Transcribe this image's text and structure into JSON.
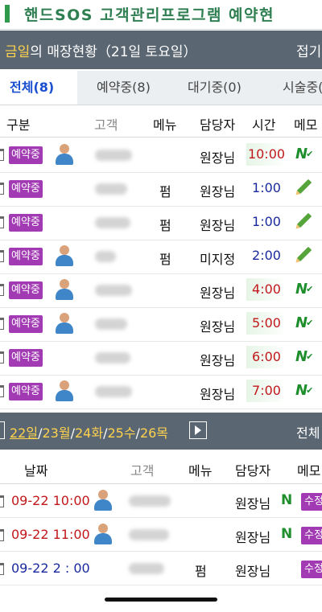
{
  "app_title": "핸드SOS 고객관리프로그램 예약현",
  "status_header": {
    "prefix": "금일",
    "text": "의 매장현황（21일 토요일）",
    "collapse_label": "접기"
  },
  "tabs": [
    {
      "label": "전체(8)",
      "active": true
    },
    {
      "label": "예약중(8)",
      "active": false
    },
    {
      "label": "대기중(0)",
      "active": false
    },
    {
      "label": "시술중(",
      "active": false
    }
  ],
  "today_table": {
    "columns": [
      "구분",
      "고객",
      "메뉴",
      "담당자",
      "시간",
      "메모"
    ],
    "rows": [
      {
        "status": "예약중",
        "has_avatar": true,
        "menu": "",
        "staff": "원장님",
        "time": "10:00",
        "memo": "N"
      },
      {
        "status": "예약중",
        "has_avatar": false,
        "menu": "펌",
        "staff": "원장님",
        "time": "1:00",
        "memo": "pencil"
      },
      {
        "status": "예약중",
        "has_avatar": false,
        "menu": "펌",
        "staff": "원장님",
        "time": "1:00",
        "memo": "pencil"
      },
      {
        "status": "예약중",
        "has_avatar": true,
        "menu": "펌",
        "staff": "미지정",
        "time": "2:00",
        "memo": "pencil"
      },
      {
        "status": "예약중",
        "has_avatar": true,
        "menu": "",
        "staff": "원장님",
        "time": "4:00",
        "memo": "N"
      },
      {
        "status": "예약중",
        "has_avatar": true,
        "menu": "",
        "staff": "원장님",
        "time": "5:00",
        "memo": "N"
      },
      {
        "status": "예약중",
        "has_avatar": false,
        "menu": "",
        "staff": "원장님",
        "time": "6:00",
        "memo": "N"
      },
      {
        "status": "예약중",
        "has_avatar": true,
        "menu": "",
        "staff": "원장님",
        "time": "7:00",
        "memo": "N"
      }
    ]
  },
  "date_bar": {
    "dates": [
      "22일",
      "23월",
      "24화",
      "25수",
      "26목"
    ],
    "selected_index": 0,
    "all_label": "전체"
  },
  "upcoming_table": {
    "columns": [
      "날짜",
      "고객",
      "메뉴",
      "담당자",
      "메모"
    ],
    "rows": [
      {
        "datetime": "09-22 10:00",
        "has_avatar": true,
        "menu": "",
        "staff": "원장님",
        "memo_n": true,
        "edit": "수정",
        "color": "red"
      },
      {
        "datetime": "09-22 11:00",
        "has_avatar": true,
        "menu": "",
        "staff": "원장님",
        "memo_n": true,
        "edit": "수정",
        "color": "red"
      },
      {
        "datetime": "09-22 2 : 00",
        "has_avatar": false,
        "menu": "펌",
        "staff": "원장님",
        "memo_n": false,
        "edit": "수정",
        "color": "blue"
      }
    ]
  },
  "colors": {
    "header_bg": "#5a6672",
    "badge_purple": "#a23bb3",
    "accent_yellow": "#ffd34d",
    "time_red": "#c0181b",
    "time_blue": "#1a2a9c"
  }
}
